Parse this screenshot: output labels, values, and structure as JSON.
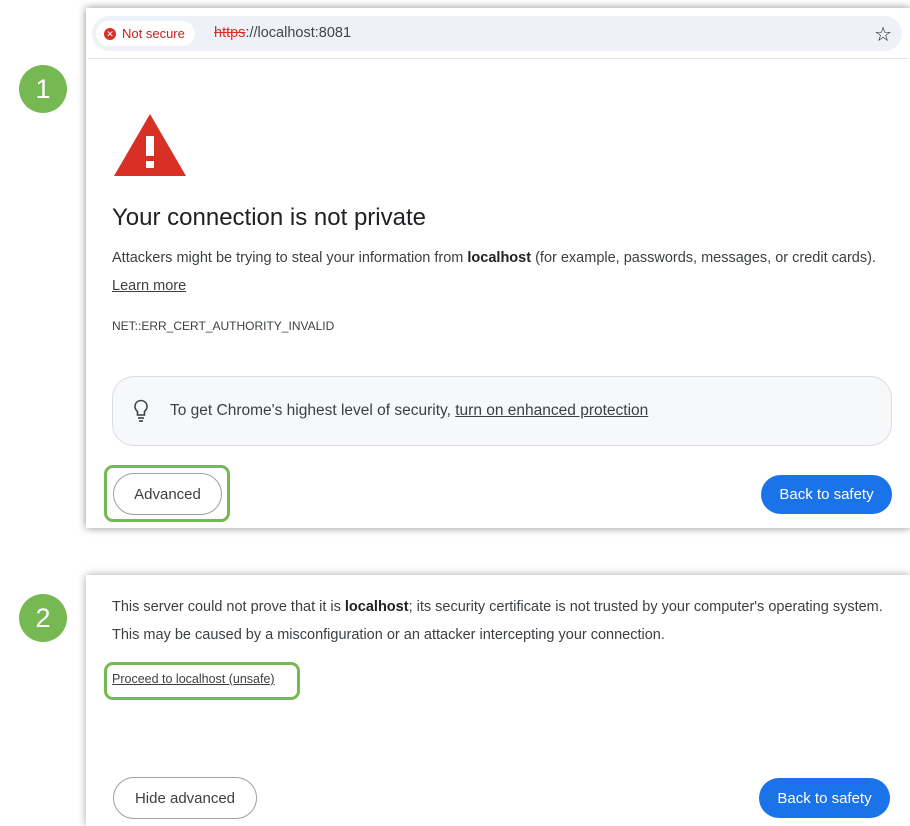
{
  "steps": [
    "1",
    "2"
  ],
  "address_bar": {
    "security_chip": "Not secure",
    "url_scheme": "https",
    "url_rest": "://localhost:8081",
    "bookmark_icon": "star-icon"
  },
  "warning": {
    "icon": "warning-triangle-icon",
    "title": "Your connection is not private",
    "body_pre": "Attackers might be trying to steal your information from ",
    "body_host": "localhost",
    "body_post": " (for example, passwords, messages, or credit cards).",
    "learn_more": "Learn more",
    "error_code": "NET::ERR_CERT_AUTHORITY_INVALID"
  },
  "enhanced_hint": {
    "icon": "lightbulb-icon",
    "text": "To get Chrome's highest level of security,",
    "link": "turn on enhanced protection"
  },
  "buttons": {
    "advanced": "Advanced",
    "back_to_safety": "Back to safety",
    "hide_advanced": "Hide advanced"
  },
  "advanced_panel": {
    "text_pre": "This server could not prove that it is ",
    "text_host": "localhost",
    "text_post": "; its security certificate is not trusted by your computer's operating system. This may be caused by a misconfiguration or an attacker intercepting your connection.",
    "proceed_link": "Proceed to localhost (unsafe)"
  },
  "colors": {
    "accent_green": "#76b852",
    "button_blue": "#1a73e8",
    "warning_red": "#d93025"
  }
}
